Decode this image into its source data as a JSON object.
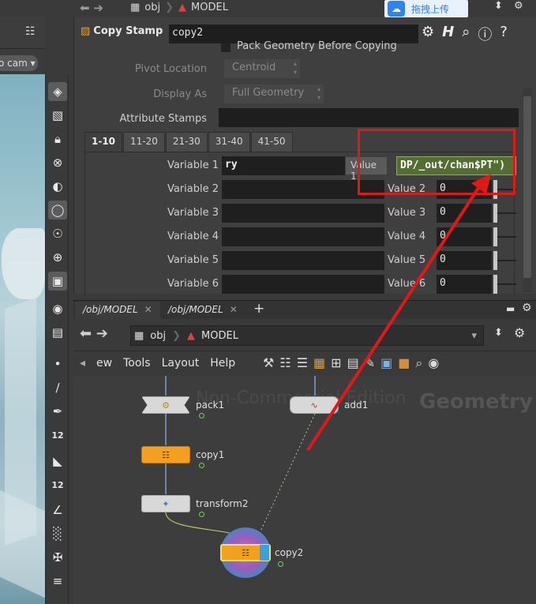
{
  "viewport": {
    "camera_label": "o cam"
  },
  "vtoolbar": {
    "badge_12a": "12",
    "badge_12b": "12"
  },
  "topbar": {
    "path": [
      "obj",
      "MODEL"
    ],
    "upload_label": "拖拽上传",
    "upload_icon": "cloud-icon"
  },
  "param_pane": {
    "node_type": "Copy Stamp",
    "node_name": "copy2",
    "pack_checkbox_label": "Pack Geometry Before Copying",
    "pivot_location_label": "Pivot Location",
    "pivot_location_value": "Centroid",
    "display_as_label": "Display As",
    "display_as_value": "Full Geometry",
    "attribute_stamps_label": "Attribute Stamps",
    "tabs": [
      "1-10",
      "11-20",
      "21-30",
      "31-40",
      "41-50"
    ],
    "variables": [
      {
        "label": "Variable 1",
        "name": "ry",
        "value_label": "Value 1",
        "value": "DP/_out/chan$PT\")"
      },
      {
        "label": "Variable 2",
        "name": "",
        "value_label": "Value 2",
        "value": "0"
      },
      {
        "label": "Variable 3",
        "name": "",
        "value_label": "Value 3",
        "value": "0"
      },
      {
        "label": "Variable 4",
        "name": "",
        "value_label": "Value 4",
        "value": "0"
      },
      {
        "label": "Variable 5",
        "name": "",
        "value_label": "Value 5",
        "value": "0"
      },
      {
        "label": "Variable 6",
        "name": "",
        "value_label": "Value 6",
        "value": "0"
      }
    ]
  },
  "network_tabs": [
    "/obj/MODEL",
    "/obj/MODEL"
  ],
  "network_path": [
    "obj",
    "MODEL"
  ],
  "network_menus": [
    "ew",
    "Tools",
    "Layout",
    "Help"
  ],
  "network_editor": {
    "watermark": "Non-Commercial Edition",
    "context_label": "Geometry",
    "nodes": [
      "pack1",
      "add1",
      "copy1",
      "transform2",
      "copy2"
    ]
  },
  "annotation_color": "#e01818"
}
